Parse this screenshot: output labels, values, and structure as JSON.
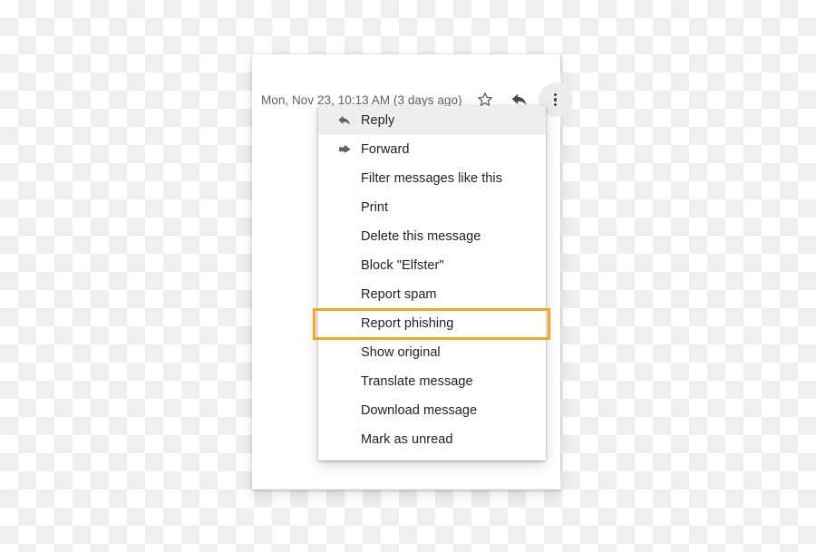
{
  "background": {
    "type": "transparency-checkerboard",
    "light": "#ffffff",
    "dark": "#efefef",
    "square_size_px": 20
  },
  "message_card": {
    "header": {
      "date_text": "Mon, Nov 23, 10:13 AM (3 days ago)",
      "actions": [
        {
          "name": "star-icon",
          "label": "Star",
          "style": "outline"
        },
        {
          "name": "reply-icon",
          "label": "Reply",
          "style": "solid"
        },
        {
          "name": "more-options-icon",
          "label": "More",
          "style": "three-dots",
          "active": true
        }
      ]
    }
  },
  "context_menu": {
    "items": [
      {
        "label": "Reply",
        "icon": "reply-icon",
        "hovered": true,
        "highlighted": false
      },
      {
        "label": "Forward",
        "icon": "forward-icon",
        "hovered": false,
        "highlighted": false
      },
      {
        "label": "Filter messages like this",
        "icon": null,
        "hovered": false,
        "highlighted": false
      },
      {
        "label": "Print",
        "icon": null,
        "hovered": false,
        "highlighted": false
      },
      {
        "label": "Delete this message",
        "icon": null,
        "hovered": false,
        "highlighted": false
      },
      {
        "label": "Block \"Elfster\"",
        "icon": null,
        "hovered": false,
        "highlighted": false
      },
      {
        "label": "Report spam",
        "icon": null,
        "hovered": false,
        "highlighted": false
      },
      {
        "label": "Report phishing",
        "icon": null,
        "hovered": false,
        "highlighted": true
      },
      {
        "label": "Show original",
        "icon": null,
        "hovered": false,
        "highlighted": false
      },
      {
        "label": "Translate message",
        "icon": null,
        "hovered": false,
        "highlighted": false
      },
      {
        "label": "Download message",
        "icon": null,
        "hovered": false,
        "highlighted": false
      },
      {
        "label": "Mark as unread",
        "icon": null,
        "hovered": false,
        "highlighted": false
      }
    ]
  },
  "annotation": {
    "target_label": "Report phishing",
    "border_color": "#f5a623",
    "border_width_px": 3
  },
  "colors": {
    "menu_text": "#222222",
    "date_text": "#5f6368",
    "hover_row": "#eeeeee",
    "icon": "#5f6368",
    "more_button_bg": "#ececec",
    "card_bg": "#ffffff",
    "accent_orange": "#f5a623"
  }
}
